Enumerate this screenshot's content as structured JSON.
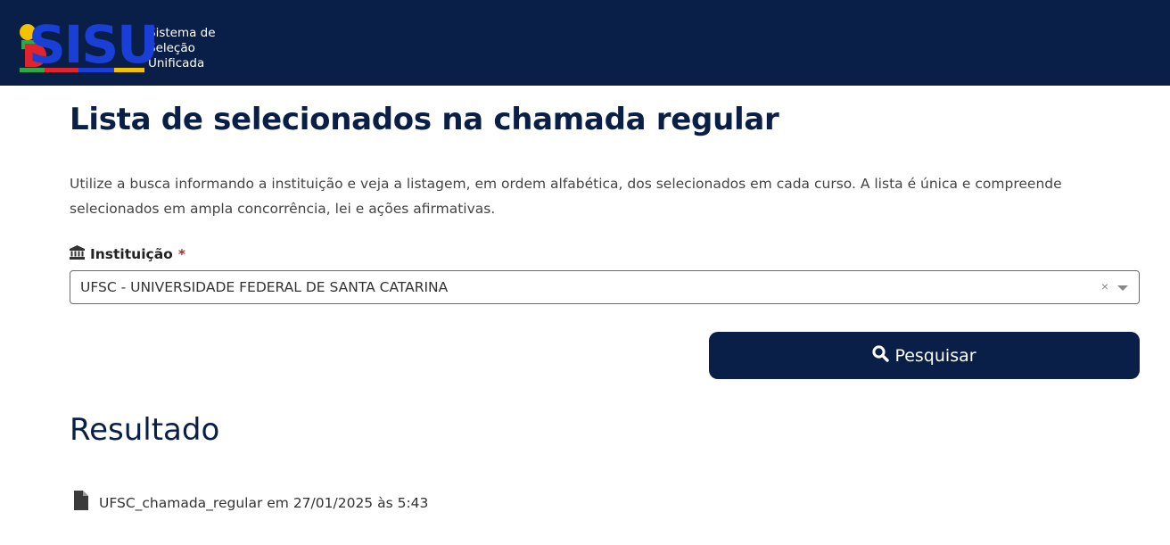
{
  "header": {
    "logo_letters": "SISU",
    "logo_text_line1": "Sistema de",
    "logo_text_line2": "Seleção",
    "logo_text_line3": "Unificada"
  },
  "main": {
    "title": "Lista de selecionados na chamada regular",
    "intro": "Utilize a busca informando a instituição e veja a listagem, em ordem alfabética, dos selecionados em cada curso. A lista é única e compreende selecionados em ampla concorrência, lei e ações afirmativas."
  },
  "form": {
    "institution_label": "Instituição",
    "required_mark": "*",
    "institution_value": "UFSC - UNIVERSIDADE FEDERAL DE SANTA CATARINA",
    "clear_symbol": "×",
    "search_button_label": "Pesquisar"
  },
  "result": {
    "title": "Resultado",
    "file_link": "UFSC_chamada_regular em 27/01/2025 às 5:43"
  },
  "colors": {
    "navy": "#091f47",
    "required": "#c0262d"
  },
  "icons": {
    "institution": "bank-icon",
    "search": "search-icon",
    "file": "file-icon",
    "clear": "clear-icon",
    "dropdown": "chevron-down-icon"
  }
}
